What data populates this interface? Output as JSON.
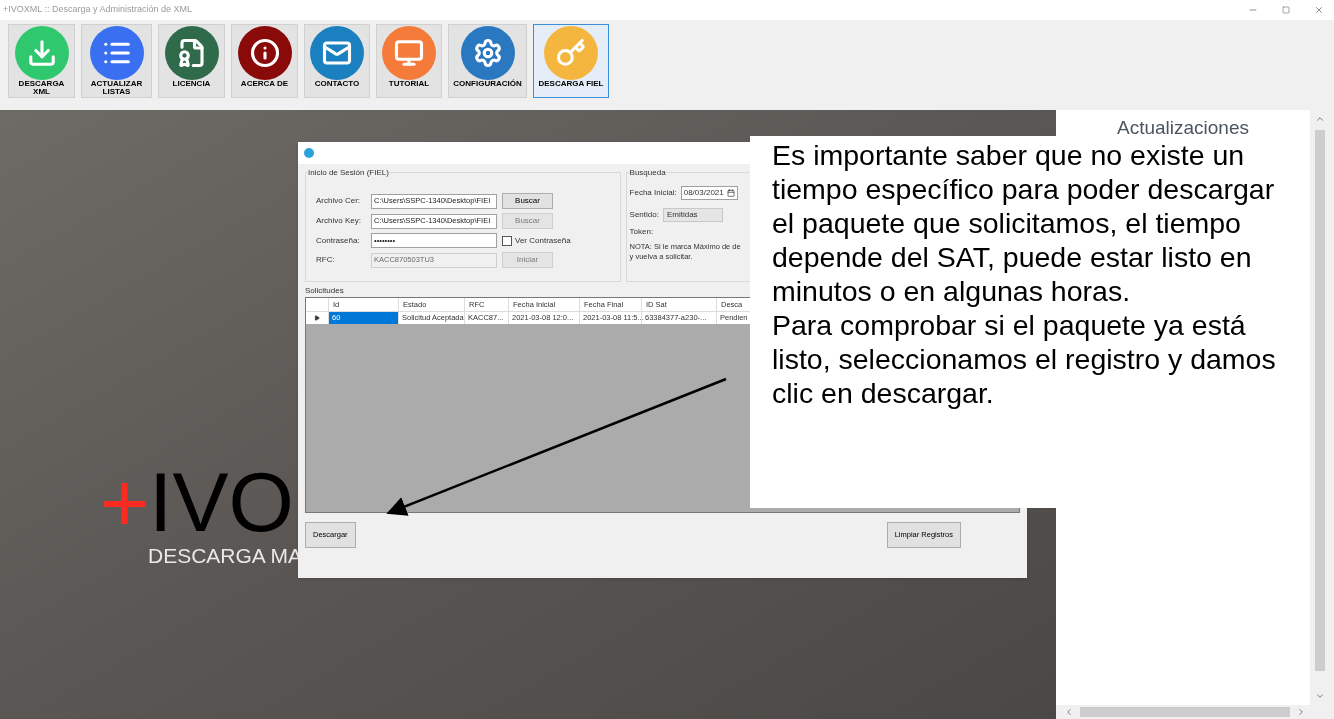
{
  "window": {
    "title": "+IVOXML :: Descarga y Administración de XML"
  },
  "toolbar": [
    {
      "label": "DESCARGA XML",
      "selected": false
    },
    {
      "label": "ACTUALIZAR LISTAS",
      "selected": false
    },
    {
      "label": "LICENCIA",
      "selected": false
    },
    {
      "label": "ACERCA DE",
      "selected": false
    },
    {
      "label": "CONTACTO",
      "selected": false
    },
    {
      "label": "TUTORIAL",
      "selected": false
    },
    {
      "label": "CONFIGURACIÓN",
      "selected": false
    },
    {
      "label": "DESCARGA FIEL",
      "selected": true
    }
  ],
  "background": {
    "logo": "+IVO",
    "tagline": "DESCARGA MA"
  },
  "dialog": {
    "login": {
      "title": "Inicio de Sesión (FIEL)",
      "rows": [
        {
          "label": "Archivo Cer:",
          "value": "C:\\Users\\SSPC-1340\\Desktop\\FIEI",
          "disabled": false,
          "button": {
            "label": "Buscar",
            "disabled": false
          }
        },
        {
          "label": "Archivo Key:",
          "value": "C:\\Users\\SSPC-1340\\Desktop\\FIEI",
          "disabled": false,
          "button": {
            "label": "Buscar",
            "disabled": true
          }
        },
        {
          "label": "Contraseña:",
          "value": "••••••••",
          "disabled": false,
          "checkbox": {
            "label": "Ver Contraseña",
            "checked": false
          }
        },
        {
          "label": "RFC:",
          "value": "KACC870503TU3",
          "disabled": true,
          "button": {
            "label": "Iniciar",
            "disabled": true
          }
        }
      ]
    },
    "search": {
      "title": "Busqueda",
      "start_label": "Fecha Inicial:",
      "start_value": "08/03/2021",
      "direction_label": "Sentido:",
      "direction_value": "Emitidas",
      "token_label": "Token:",
      "note": [
        "NOTA: Si le marca Máximo de de",
        "y vuelva a solicitar."
      ]
    },
    "requests": {
      "title": "Solicitudes",
      "columns": [
        "Id",
        "Estado",
        "RFC",
        "Fecha Inicial",
        "Fecha Final",
        "ID Sat",
        "Desca"
      ],
      "rows": [
        {
          "selected": true,
          "cells": [
            "60",
            "Solicitud Aceptada",
            "KACC87...",
            "2021-03-08 12:0...",
            "2021-03-08 11:5...",
            "63384377-a230-...",
            "Pendien"
          ]
        }
      ]
    },
    "buttons": [
      "Descargar",
      "Limpiar Registros"
    ]
  },
  "callout": {
    "paragraphs": [
      "Es importante saber que no existe un tiempo específico para poder descargar el paquete que solicitamos, el tiempo depende del SAT, puede estar listo en minutos o en algunas horas.",
      "Para comprobar si el paquete ya está listo, seleccionamos el registro y damos clic en descargar."
    ]
  },
  "updates": {
    "title": "Actualizaciones"
  }
}
